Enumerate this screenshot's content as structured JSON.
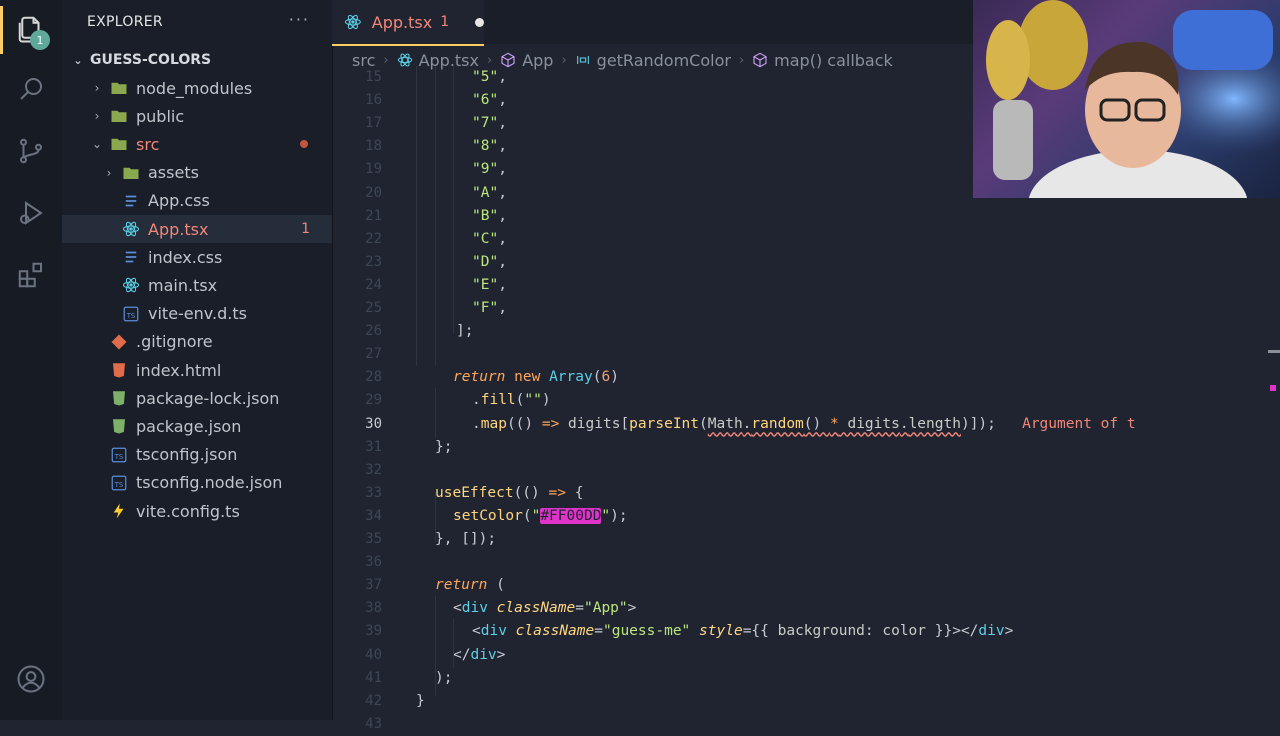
{
  "activity_bar": {
    "explorer_badge": "1"
  },
  "explorer": {
    "title": "EXPLORER",
    "more": "···",
    "root": "GUESS-COLORS",
    "items": [
      {
        "label": "node_modules",
        "type": "folder",
        "indent": 1,
        "chevron": "›"
      },
      {
        "label": "public",
        "type": "folder",
        "indent": 1,
        "chevron": "›"
      },
      {
        "label": "src",
        "type": "folder-open",
        "indent": 1,
        "chevron": "⌄",
        "modified": true
      },
      {
        "label": "assets",
        "type": "folder",
        "indent": 2,
        "chevron": "›"
      },
      {
        "label": "App.css",
        "type": "css",
        "indent": 2
      },
      {
        "label": "App.tsx",
        "type": "react",
        "indent": 2,
        "selected": true,
        "problems": "1"
      },
      {
        "label": "index.css",
        "type": "css",
        "indent": 2
      },
      {
        "label": "main.tsx",
        "type": "react",
        "indent": 2
      },
      {
        "label": "vite-env.d.ts",
        "type": "ts",
        "indent": 2
      },
      {
        "label": ".gitignore",
        "type": "git",
        "indent": 1
      },
      {
        "label": "index.html",
        "type": "html",
        "indent": 1
      },
      {
        "label": "package-lock.json",
        "type": "json",
        "indent": 1
      },
      {
        "label": "package.json",
        "type": "json",
        "indent": 1
      },
      {
        "label": "tsconfig.json",
        "type": "ts",
        "indent": 1
      },
      {
        "label": "tsconfig.node.json",
        "type": "ts",
        "indent": 1
      },
      {
        "label": "vite.config.ts",
        "type": "vite",
        "indent": 1
      }
    ]
  },
  "tab": {
    "name": "App.tsx",
    "problems": "1"
  },
  "breadcrumb": [
    "src",
    "App.tsx",
    "App",
    "getRandomColor",
    "map() callback"
  ],
  "code": {
    "active_line": "30",
    "lines": [
      {
        "n": "15",
        "html": "<span class='s'>\"5\"</span><span class='p'>,</span>"
      },
      {
        "n": "16",
        "html": "<span class='s'>\"6\"</span><span class='p'>,</span>"
      },
      {
        "n": "17",
        "html": "<span class='s'>\"7\"</span><span class='p'>,</span>"
      },
      {
        "n": "18",
        "html": "<span class='s'>\"8\"</span><span class='p'>,</span>"
      },
      {
        "n": "19",
        "html": "<span class='s'>\"9\"</span><span class='p'>,</span>"
      },
      {
        "n": "20",
        "html": "<span class='s'>\"A\"</span><span class='p'>,</span>"
      },
      {
        "n": "21",
        "html": "<span class='s'>\"B\"</span><span class='p'>,</span>"
      },
      {
        "n": "22",
        "html": "<span class='s'>\"C\"</span><span class='p'>,</span>"
      },
      {
        "n": "23",
        "html": "<span class='s'>\"D\"</span><span class='p'>,</span>"
      },
      {
        "n": "24",
        "html": "<span class='s'>\"E\"</span><span class='p'>,</span>"
      },
      {
        "n": "25",
        "html": "<span class='s'>\"F\"</span><span class='p'>,</span>"
      },
      {
        "n": "26",
        "html": "<span class='p'>];</span>"
      },
      {
        "n": "27",
        "html": ""
      },
      {
        "n": "28",
        "html": "<span class='k'>return</span> <span class='kw'>new</span> <span class='t'>Array</span><span class='p'>(</span><span class='m'>6</span><span class='p'>)</span>"
      },
      {
        "n": "29",
        "html": "<span class='p'>.</span><span class='f'>fill</span><span class='p'>(</span><span class='s'>\"\"</span><span class='p'>)</span>"
      },
      {
        "n": "30",
        "html": "<span class='p'>.</span><span class='f'>map</span><span class='p'>(() </span><span class='kw'>=></span><span class='v'> digits</span><span class='p'>[</span><span class='f'>parseInt</span><span class='p'>(</span><span class='sq'><span class='v'>Math</span><span class='p'>.</span><span class='f'>random</span><span class='p'>() </span><span class='kw'>*</span><span class='v'> digits</span><span class='p'>.</span><span class='v'>length</span></span><span class='p'>)]);</span>   <span class='err'>Argument of t</span>"
      },
      {
        "n": "31",
        "html": "<span class='p'>};</span>"
      },
      {
        "n": "32",
        "html": ""
      },
      {
        "n": "33",
        "html": "<span class='f'>useEffect</span><span class='p'>(() </span><span class='kw'>=></span><span class='p'> {</span>"
      },
      {
        "n": "34",
        "html": "<span class='f'>setColor</span><span class='p'>(</span><span class='s'>\"</span><span class='hl'>#FF00DD</span><span class='s'>\"</span><span class='p'>);</span>"
      },
      {
        "n": "35",
        "html": "<span class='p'>}, []);</span>"
      },
      {
        "n": "36",
        "html": ""
      },
      {
        "n": "37",
        "html": "<span class='k'>return</span><span class='p'> (</span>"
      },
      {
        "n": "38",
        "html": "<span class='p'>&lt;</span><span class='t'>div</span> <span class='a'>className</span><span class='p'>=</span><span class='s'>\"App\"</span><span class='p'>&gt;</span>"
      },
      {
        "n": "39",
        "html": "<span class='p'>&lt;</span><span class='t'>div</span> <span class='a'>className</span><span class='p'>=</span><span class='s'>\"guess-me\"</span> <span class='a'>style</span><span class='p'>={{ </span><span class='v'>background: color </span><span class='p'>}}&gt;&lt;/</span><span class='t'>div</span><span class='p'>&gt;</span>"
      },
      {
        "n": "40",
        "html": "<span class='p'>&lt;/</span><span class='t'>div</span><span class='p'>&gt;</span>"
      },
      {
        "n": "41",
        "html": "<span class='p'>);</span>"
      },
      {
        "n": "42",
        "html": "<span class='p'>}</span>"
      },
      {
        "n": "43",
        "html": ""
      }
    ]
  },
  "colors": {
    "accent": "#ffcc66",
    "error": "#f28779",
    "highlight": "#e033c9"
  }
}
